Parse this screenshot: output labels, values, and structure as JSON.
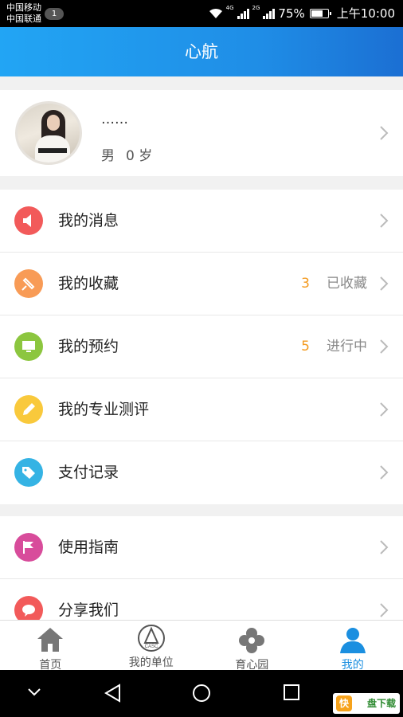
{
  "status_bar": {
    "carrier_1": "中国移动",
    "carrier_2": "中国联通",
    "notification_count": "1",
    "net_1": "4G",
    "net_2": "2G",
    "battery": "75%",
    "battery_level": 0.75,
    "time": "上午10:00"
  },
  "header": {
    "title": "心航"
  },
  "profile": {
    "name": "……",
    "gender": "男",
    "age": "0 岁"
  },
  "menu_group_1": [
    {
      "label": "我的消息",
      "icon": "speaker-icon",
      "color": "#f25a5a",
      "count": "",
      "status": ""
    },
    {
      "label": "我的收藏",
      "icon": "bookmark-icon",
      "color": "#f89b56",
      "count": "3",
      "status": "已收藏"
    },
    {
      "label": "我的预约",
      "icon": "monitor-icon",
      "color": "#8cc63f",
      "count": "5",
      "status": "进行中"
    },
    {
      "label": "我的专业测评",
      "icon": "pencil-icon",
      "color": "#f9c93c",
      "count": "",
      "status": ""
    },
    {
      "label": "支付记录",
      "icon": "tag-icon",
      "color": "#35b3e4",
      "count": "",
      "status": ""
    }
  ],
  "menu_group_2": [
    {
      "label": "使用指南",
      "icon": "flag-icon",
      "color": "#d84c9b"
    },
    {
      "label": "分享我们",
      "icon": "chat-bubble-icon",
      "color": "#f25a5a"
    }
  ],
  "tabs": [
    {
      "label": "首页",
      "icon": "home-icon",
      "active": false
    },
    {
      "label": "我的单位",
      "icon": "unit-logo-icon",
      "active": false,
      "logo_text": "CASC"
    },
    {
      "label": "育心园",
      "icon": "flower-icon",
      "active": false
    },
    {
      "label": "我的",
      "icon": "person-icon",
      "active": true
    }
  ],
  "colors": {
    "accent": "#1b8fe0",
    "header_start": "#22a5f4",
    "header_end": "#1b6fd3",
    "count": "#f39a1f"
  },
  "watermark": {
    "k": "快",
    "text": "盘下载"
  }
}
